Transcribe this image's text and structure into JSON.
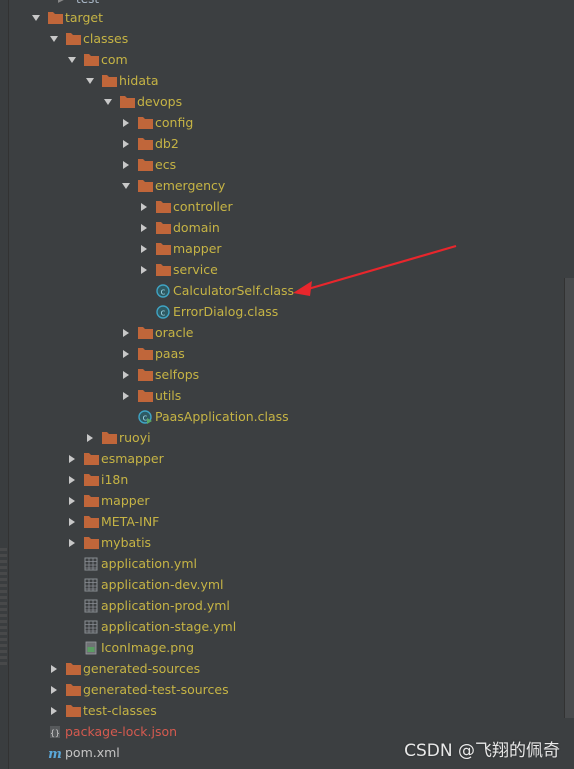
{
  "top_partial": {
    "label": "test"
  },
  "tree": [
    {
      "label": "target",
      "kind": "folder",
      "expanded": true,
      "color": "orange"
    },
    {
      "label": "classes",
      "kind": "folder",
      "expanded": true,
      "color": "orange"
    },
    {
      "label": "com",
      "kind": "folder",
      "expanded": true,
      "color": "orange"
    },
    {
      "label": "hidata",
      "kind": "folder",
      "expanded": true,
      "color": "orange"
    },
    {
      "label": "devops",
      "kind": "folder",
      "expanded": true,
      "color": "orange"
    },
    {
      "label": "config",
      "kind": "folder",
      "expanded": false,
      "color": "orange"
    },
    {
      "label": "db2",
      "kind": "folder",
      "expanded": false,
      "color": "orange"
    },
    {
      "label": "ecs",
      "kind": "folder",
      "expanded": false,
      "color": "orange"
    },
    {
      "label": "emergency",
      "kind": "folder",
      "expanded": true,
      "color": "orange"
    },
    {
      "label": "controller",
      "kind": "folder",
      "expanded": false,
      "color": "orange"
    },
    {
      "label": "domain",
      "kind": "folder",
      "expanded": false,
      "color": "orange"
    },
    {
      "label": "mapper",
      "kind": "folder",
      "expanded": false,
      "color": "orange"
    },
    {
      "label": "service",
      "kind": "folder",
      "expanded": false,
      "color": "orange"
    },
    {
      "label": "CalculatorSelf.class",
      "kind": "class",
      "color": "orange"
    },
    {
      "label": "ErrorDialog.class",
      "kind": "class",
      "color": "orange"
    },
    {
      "label": "oracle",
      "kind": "folder",
      "expanded": false,
      "color": "orange"
    },
    {
      "label": "paas",
      "kind": "folder",
      "expanded": false,
      "color": "orange"
    },
    {
      "label": "selfops",
      "kind": "folder",
      "expanded": false,
      "color": "orange"
    },
    {
      "label": "utils",
      "kind": "folder",
      "expanded": false,
      "color": "orange"
    },
    {
      "label": "PaasApplication.class",
      "kind": "class-main",
      "color": "orange"
    },
    {
      "label": "ruoyi",
      "kind": "folder",
      "expanded": false,
      "color": "orange"
    },
    {
      "label": "esmapper",
      "kind": "folder",
      "expanded": false,
      "color": "orange"
    },
    {
      "label": "i18n",
      "kind": "folder",
      "expanded": false,
      "color": "orange"
    },
    {
      "label": "mapper",
      "kind": "folder",
      "expanded": false,
      "color": "orange"
    },
    {
      "label": "META-INF",
      "kind": "folder",
      "expanded": false,
      "color": "orange"
    },
    {
      "label": "mybatis",
      "kind": "folder",
      "expanded": false,
      "color": "orange"
    },
    {
      "label": "application.yml",
      "kind": "yml",
      "color": "orange"
    },
    {
      "label": "application-dev.yml",
      "kind": "yml",
      "color": "orange"
    },
    {
      "label": "application-prod.yml",
      "kind": "yml",
      "color": "orange"
    },
    {
      "label": "application-stage.yml",
      "kind": "yml",
      "color": "orange"
    },
    {
      "label": "IconImage.png",
      "kind": "png",
      "color": "orange"
    },
    {
      "label": "generated-sources",
      "kind": "folder",
      "expanded": false,
      "color": "orange"
    },
    {
      "label": "generated-test-sources",
      "kind": "folder",
      "expanded": false,
      "color": "orange"
    },
    {
      "label": "test-classes",
      "kind": "folder",
      "expanded": false,
      "color": "orange"
    },
    {
      "label": "package-lock.json",
      "kind": "json",
      "color": "red"
    },
    {
      "label": "pom.xml",
      "kind": "maven",
      "color": "grey"
    }
  ],
  "watermark": {
    "text": "CSDN @飞翔的佩奇"
  },
  "colors": {
    "background": "#3c3f41",
    "folder": "#c0663a",
    "label_ignored": "#b4a93e",
    "label_untracked": "#d55a4f",
    "annotation_arrow": "#e8262c",
    "class_icon": "#3fa4c4"
  }
}
